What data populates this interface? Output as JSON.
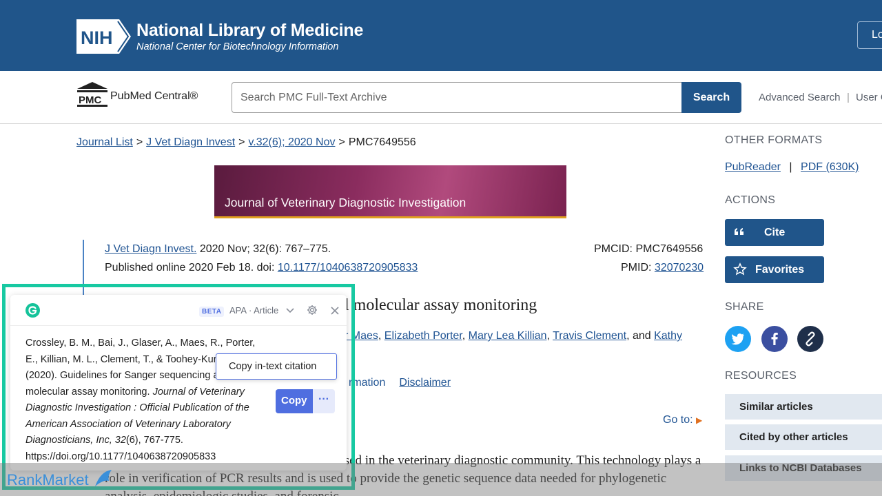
{
  "header": {
    "logo_text": "NIH",
    "title": "National Library of Medicine",
    "subtitle": "National Center for Biotechnology Information",
    "login_label": "Log in"
  },
  "pmc": {
    "logo_text": "PMC",
    "brand": "PubMed Central®",
    "search_placeholder": "Search PMC Full-Text Archive",
    "search_button": "Search",
    "advanced_search": "Advanced Search",
    "separator": "|",
    "user_guide": "User Guide"
  },
  "breadcrumb": [
    {
      "label": "Journal List",
      "link": true
    },
    {
      "label": "J Vet Diagn Invest",
      "link": true
    },
    {
      "label": "v.32(6); 2020 Nov",
      "link": true
    },
    {
      "label": "PMC7649556",
      "link": false
    }
  ],
  "breadcrumb_sep": ">",
  "banner": {
    "title": "Journal of Veterinary Diagnostic Investigation"
  },
  "citation_info": {
    "journal_link": "J Vet Diagn Invest.",
    "journal_rest": " 2020 Nov; 32(6): 767–775.",
    "published_prefix": "Published online 2020 Feb 18. doi: ",
    "doi": "10.1177/1040638720905833",
    "pmcid": "PMCID: PMC7649556",
    "pmid_label": "PMID: ",
    "pmid": "32070230"
  },
  "article": {
    "title_visible": "l molecular assay monitoring",
    "authors": [
      {
        "text": "r Maes",
        "link": true
      },
      {
        "text": ", ",
        "link": false
      },
      {
        "text": "Elizabeth Porter",
        "link": true
      },
      {
        "text": ", ",
        "link": false
      },
      {
        "text": "Mary Lea Killian",
        "link": true
      },
      {
        "text": ", ",
        "link": false
      },
      {
        "text": "Travis Clement",
        "link": true
      },
      {
        "text": ", and ",
        "link": false
      },
      {
        "text": "Kathy",
        "link": true
      }
    ],
    "info_link": "rmation",
    "disclaimer": "Disclaimer",
    "goto": "Go to:",
    "abstract": "ng the Sanger technique has become widely used in the veterinary diagnostic community. This technology plays a role in verification of PCR results and is used to provide the genetic sequence data needed for phylogenetic analysis, epidemiologic studies, and forensic"
  },
  "sidebar": {
    "other_formats": "OTHER FORMATS",
    "pubreader": "PubReader",
    "format_sep": "|",
    "pdf": "PDF (630K)",
    "actions": "ACTIONS",
    "cite": "Cite",
    "favorites": "Favorites",
    "share": "SHARE",
    "resources": "RESOURCES",
    "resource_items": [
      "Similar articles",
      "Cited by other articles",
      "Links to NCBI Databases"
    ]
  },
  "popup": {
    "beta": "BETA",
    "style": "APA · Article",
    "citation_plain_1": "Crossley, B. M., Bai, J., Glaser, A., Maes, R., Porter, E., Killian, M. L., Clement, T., & Toohey-Kurth, K. (2020). Guidelines for Sanger sequencing and molecular assay monitoring. ",
    "citation_italic": "Journal of Veterinary Diagnostic Investigation : Official Publication of the American Association of Veterinary Laboratory Diagnosticians, Inc, 32",
    "citation_plain_2": "(6), 767-775. https://doi.org/10.1177/1040638720905833",
    "copy": "Copy",
    "more": "···",
    "tooltip": "Copy in-text citation"
  },
  "watermark": {
    "text": "RankMarket"
  },
  "colors": {
    "nih_blue": "#20558a",
    "link": "#205493",
    "grammarly_green": "#15c39a",
    "highlight_frame": "#17c9a2",
    "copy_blue": "#4f6ee0",
    "twitter": "#1da1f2",
    "facebook": "#3b4fa0",
    "permalink": "#1f2f4a"
  },
  "icons": [
    "nih-logo-icon",
    "pmc-building-icon",
    "quote-icon",
    "star-icon",
    "twitter-icon",
    "facebook-icon",
    "link-icon",
    "grammarly-icon",
    "chevron-down-icon",
    "gear-icon",
    "close-icon",
    "go-to-arrow-icon"
  ]
}
